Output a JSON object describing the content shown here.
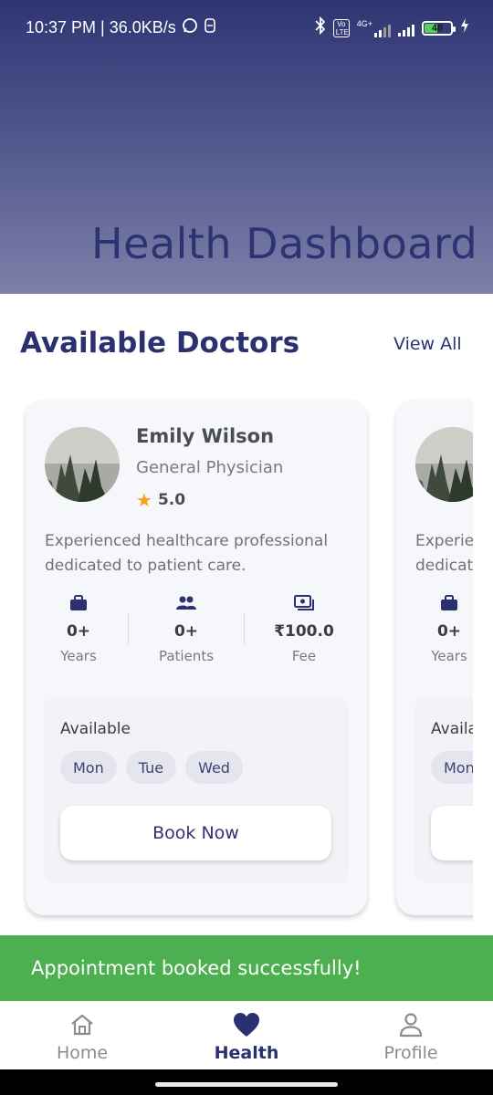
{
  "status_bar": {
    "time_and_speed": "10:37 PM | 36.0KB/s",
    "network_label": "4G+",
    "volte_label": "Vo LTE",
    "battery": "48"
  },
  "header": {
    "title": "Health Dashboard"
  },
  "section": {
    "title": "Available Doctors",
    "view_all": "View All"
  },
  "doctors": [
    {
      "name": "Emily Wilson",
      "specialty": "General Physician",
      "rating": "5.0",
      "description": "Experienced healthcare professional dedicated to patient care.",
      "stats": [
        {
          "value": "0+",
          "label": "Years",
          "icon": "briefcase-icon"
        },
        {
          "value": "0+",
          "label": "Patients",
          "icon": "people-icon"
        },
        {
          "value": "₹100.0",
          "label": "Fee",
          "icon": "money-icon"
        }
      ],
      "availability_label": "Available",
      "days": [
        "Mon",
        "Tue",
        "Wed"
      ],
      "book_label": "Book Now"
    },
    {
      "description": "Experienced healthcare professional dedicated to patient care.",
      "stats": [
        {
          "value": "0+",
          "label": "Years",
          "icon": "briefcase-icon"
        }
      ],
      "availability_label": "Available",
      "days": [
        "Mon"
      ]
    }
  ],
  "snackbar": {
    "message": "Appointment booked successfully!"
  },
  "bottom_nav": {
    "items": [
      {
        "label": "Home",
        "icon": "home-icon"
      },
      {
        "label": "Health",
        "icon": "heart-icon",
        "active": true
      },
      {
        "label": "Profile",
        "icon": "person-icon"
      }
    ]
  },
  "colors": {
    "primary": "#2b3070",
    "snackbar": "#4caf50",
    "star": "#f4a21d"
  }
}
